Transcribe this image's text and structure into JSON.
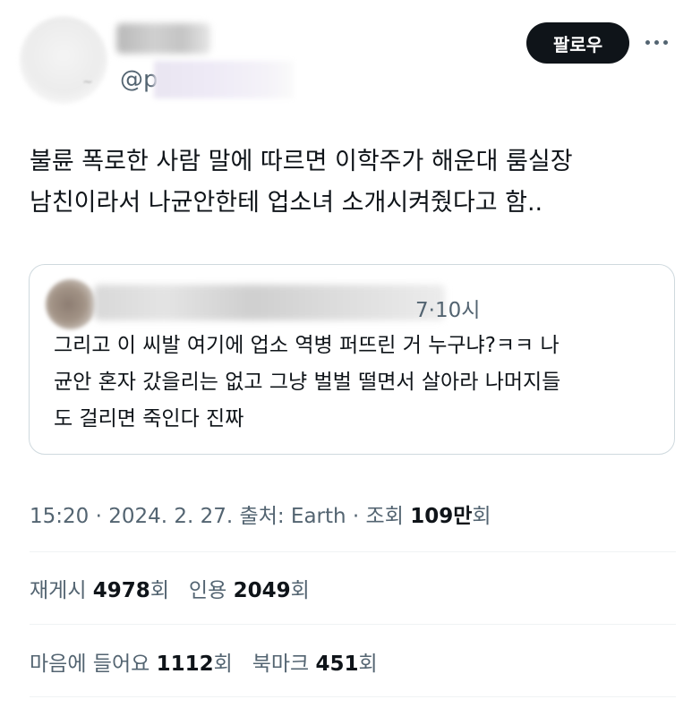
{
  "header": {
    "name": "",
    "handle_prefix": "@p",
    "follow_label": "팔로우",
    "more_icon": "more-horizontal-icon"
  },
  "tweet": {
    "lines": [
      "불륜 폭로한 사람 말에 따르면 이학주가 해운대 룸실장",
      "남친이라서 나균안한테 업소녀 소개시켜줬다고 함.."
    ]
  },
  "quote": {
    "time": "7·10시",
    "lines": [
      "그리고 이 씨발 여기에 업소 역병 퍼뜨린 거 누구냐?ㅋㅋ 나",
      "균안 혼자 갔을리는 없고 그냥 벌벌 떨면서 살아라 나머지들",
      "도 걸리면 죽인다 진짜"
    ]
  },
  "meta": {
    "time": "15:20",
    "date": "2024. 2. 27.",
    "source_label": "출처: Earth",
    "views_label": "조회",
    "views_value": "109만",
    "views_suffix": "회",
    "sep": " · "
  },
  "stats": {
    "retweets_label": "재게시",
    "retweets_value": "4978",
    "retweets_suffix": "회",
    "quotes_label": "인용",
    "quotes_value": "2049",
    "quotes_suffix": "회",
    "likes_label": "마음에 들어요",
    "likes_value": "1112",
    "likes_suffix": "회",
    "bookmarks_label": "북마크",
    "bookmarks_value": "451",
    "bookmarks_suffix": "회"
  },
  "colors": {
    "text_primary": "#0f1419",
    "text_secondary": "#536471",
    "border": "#cfd9de",
    "follow_bg": "#0f1419"
  }
}
